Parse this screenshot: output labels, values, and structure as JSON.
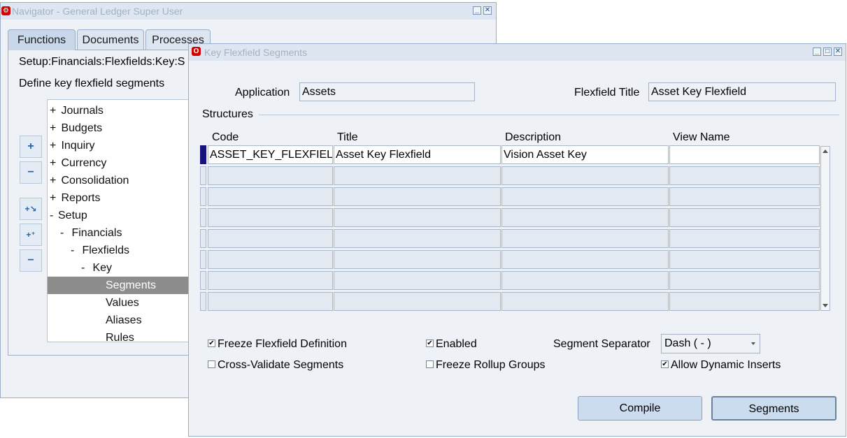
{
  "navigator": {
    "title": "Navigator - General Ledger Super User",
    "tabs": [
      {
        "label": "Functions"
      },
      {
        "label": "Documents"
      },
      {
        "label": "Processes"
      }
    ],
    "path": "Setup:Financials:Flexfields:Key:S",
    "description": "Define key flexfield segments",
    "tree": [
      {
        "sign": "+",
        "label": "Journals"
      },
      {
        "sign": "+",
        "label": "Budgets"
      },
      {
        "sign": "+",
        "label": "Inquiry"
      },
      {
        "sign": "+",
        "label": "Currency"
      },
      {
        "sign": "+",
        "label": "Consolidation"
      },
      {
        "sign": "+",
        "label": "Reports"
      },
      {
        "sign": "-",
        "label": "Setup"
      },
      {
        "sign": "-",
        "label": "Financials"
      },
      {
        "sign": "-",
        "label": "Flexfields"
      },
      {
        "sign": "-",
        "label": "Key"
      },
      {
        "sign": "",
        "label": "Segments"
      },
      {
        "sign": "",
        "label": "Values"
      },
      {
        "sign": "",
        "label": "Aliases"
      },
      {
        "sign": "",
        "label": "Rules"
      }
    ],
    "side_buttons": [
      "+",
      "−",
      "+↘",
      "+⁺",
      "−"
    ]
  },
  "kff": {
    "title": "Key Flexfield Segments",
    "application_label": "Application",
    "application_value": "Assets",
    "flexfield_title_label": "Flexfield Title",
    "flexfield_title_value": "Asset Key Flexfield",
    "structures_label": "Structures",
    "columns": [
      "Code",
      "Title",
      "Description",
      "View Name"
    ],
    "rows": [
      [
        "ASSET_KEY_FLEXFIELD",
        "Asset Key Flexfield",
        "Vision Asset Key",
        ""
      ],
      [
        "",
        "",
        "",
        ""
      ],
      [
        "",
        "",
        "",
        ""
      ],
      [
        "",
        "",
        "",
        ""
      ],
      [
        "",
        "",
        "",
        ""
      ],
      [
        "",
        "",
        "",
        ""
      ],
      [
        "",
        "",
        "",
        ""
      ],
      [
        "",
        "",
        "",
        ""
      ]
    ],
    "freeze_label": "Freeze Flexfield Definition",
    "freeze_checked": true,
    "enabled_label": "Enabled",
    "enabled_checked": true,
    "cross_validate_label": "Cross-Validate Segments",
    "cross_validate_checked": false,
    "freeze_rollup_label": "Freeze Rollup Groups",
    "freeze_rollup_checked": false,
    "separator_label": "Segment Separator",
    "separator_value": "Dash ( - )",
    "dynamic_inserts_label": "Allow Dynamic Inserts",
    "dynamic_inserts_checked": true,
    "compile_label": "Compile",
    "segments_label": "Segments"
  }
}
